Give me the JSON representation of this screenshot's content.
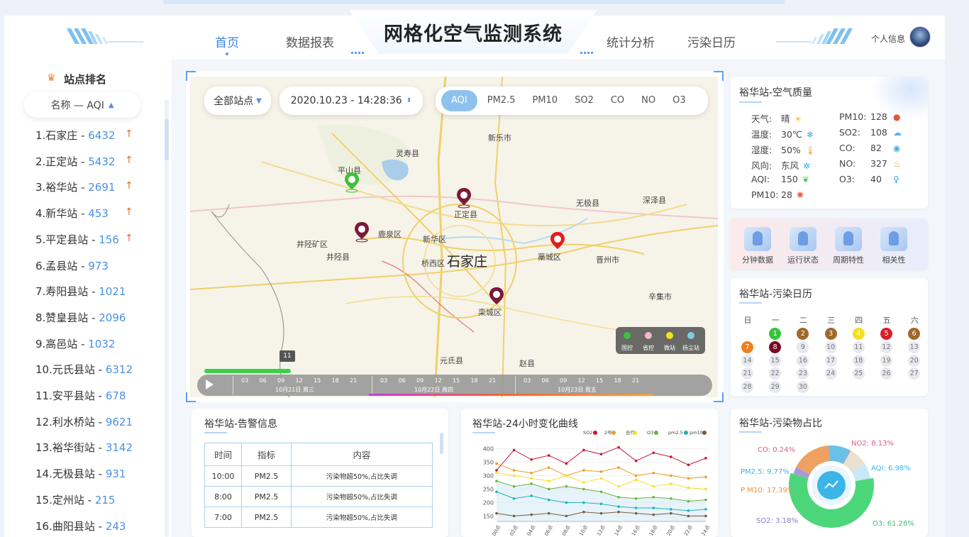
{
  "app": {
    "title": "网格化空气监测系统",
    "user_label": "个人信息"
  },
  "nav": [
    {
      "label": "首页",
      "active": true
    },
    {
      "label": "数据报表",
      "active": false
    },
    {
      "label": "统计分析",
      "active": false
    },
    {
      "label": "污染日历",
      "active": false
    }
  ],
  "ranking": {
    "title": "站点排名",
    "sort_label": "名称 — AQI",
    "items": [
      {
        "name": "1.石家庄",
        "value": "6432",
        "up": true
      },
      {
        "name": "2.正定站",
        "value": "5432",
        "up": true
      },
      {
        "name": "3.裕华站",
        "value": "2691",
        "up": true
      },
      {
        "name": "4.新华站",
        "value": "453",
        "up": true
      },
      {
        "name": "5.平定县站",
        "value": "156",
        "up": true
      },
      {
        "name": "6.孟县站",
        "value": "973",
        "up": false
      },
      {
        "name": "7.寿阳县站",
        "value": "1021",
        "up": false
      },
      {
        "name": "8.赞皇县站",
        "value": "2096",
        "up": false
      },
      {
        "name": "9.高邑站",
        "value": "1032",
        "up": false
      },
      {
        "name": "10.元氏县站",
        "value": "6312",
        "up": false
      },
      {
        "name": "11.安平县站",
        "value": "678",
        "up": false
      },
      {
        "name": "12.利水桥站",
        "value": "9621",
        "up": false
      },
      {
        "name": "13.裕华街站",
        "value": "3142",
        "up": false
      },
      {
        "name": "14.无极县站",
        "value": "931",
        "up": false
      },
      {
        "name": "15.定州站",
        "value": "215",
        "up": false
      },
      {
        "name": "16.曲阳县站",
        "value": "243",
        "up": false
      }
    ]
  },
  "map": {
    "station_select": "全部站点",
    "datetime": "2020.10.23 - 14:28:36",
    "tabs": [
      "AQI",
      "PM2.5",
      "PM10",
      "SO2",
      "CO",
      "NO",
      "O3"
    ],
    "active_tab": "AQI",
    "places": {
      "xinle": "新乐市",
      "lingshou": "灵寿县",
      "pingshan": "平山县",
      "zhengding": "正定县",
      "wuji": "无极县",
      "shenze": "深泽县",
      "jingxing_kq": "井陉矿区",
      "luquan": "鹿泉区",
      "xinhua": "新华区",
      "jingxing": "井陉县",
      "qiaoxi": "桥西区",
      "city": "石家庄",
      "gaocheng": "藁城区",
      "jinzhou": "晋州市",
      "xinji": "辛集市",
      "luancheng": "栾城区",
      "yuanshi": "元氏县",
      "zhao": "赵县"
    },
    "legend": [
      "国控",
      "省控",
      "微站",
      "扬尘站"
    ],
    "badge": "11",
    "timeline": {
      "hours": [
        "03",
        "06",
        "09",
        "12",
        "15",
        "18",
        "21"
      ],
      "days": [
        "10月21日 周三",
        "10月22日 周四",
        "10月23日 周五"
      ]
    }
  },
  "air_quality": {
    "title": "裕华站-空气质量",
    "left": [
      {
        "label": "天气:",
        "value": "晴",
        "icon": "☀",
        "color": "#f2c12e"
      },
      {
        "label": "温度:",
        "value": "30℃",
        "icon": "❄",
        "color": "#3aa6e0"
      },
      {
        "label": "湿度:",
        "value": "50%",
        "icon": "🌡",
        "color": "#f0a040"
      },
      {
        "label": "风向:",
        "value": "东风",
        "icon": "✲",
        "color": "#3aa6e0"
      },
      {
        "label": "AQI:",
        "value": "150",
        "icon": "❦",
        "color": "#5ac85a"
      },
      {
        "label": "PM10:",
        "value": "28",
        "icon": "✺",
        "color": "#e85c3a"
      }
    ],
    "right": [
      {
        "label": "PM10:",
        "value": "128",
        "icon": "●",
        "color": "#e0573a"
      },
      {
        "label": "SO2:",
        "value": "108",
        "icon": "☁",
        "color": "#5ab0e6"
      },
      {
        "label": "CO:",
        "value": "82",
        "icon": "◉",
        "color": "#4ab0d8"
      },
      {
        "label": "NO:",
        "value": "327",
        "icon": "♨",
        "color": "#f0a030"
      },
      {
        "label": "O3:",
        "value": "40",
        "icon": "♀",
        "color": "#3aa6e0"
      }
    ]
  },
  "quick_links": [
    "分钟数据",
    "运行状态",
    "周期特性",
    "相关性"
  ],
  "calendar": {
    "title": "裕华站-污染日历",
    "weekdays": [
      "日",
      "一",
      "二",
      "三",
      "四",
      "五",
      "六"
    ],
    "days": [
      {
        "d": "1",
        "color": "#3cc23c"
      },
      {
        "d": "2",
        "color": "#a0682a"
      },
      {
        "d": "3",
        "color": "#a0682a"
      },
      {
        "d": "4",
        "color": "#f5e020"
      },
      {
        "d": "5",
        "color": "#d8202a"
      },
      {
        "d": "6",
        "color": "#a0682a"
      },
      {
        "d": "7",
        "color": "#f08020"
      },
      {
        "d": "8",
        "color": "#7a0a24"
      },
      {
        "d": "9"
      },
      {
        "d": "10"
      },
      {
        "d": "11"
      },
      {
        "d": "12"
      },
      {
        "d": "13"
      },
      {
        "d": "14"
      },
      {
        "d": "15"
      },
      {
        "d": "16"
      },
      {
        "d": "17"
      },
      {
        "d": "18"
      },
      {
        "d": "19"
      },
      {
        "d": "20"
      },
      {
        "d": "21"
      },
      {
        "d": "22"
      },
      {
        "d": "23"
      },
      {
        "d": "24"
      },
      {
        "d": "25"
      },
      {
        "d": "26"
      },
      {
        "d": "27"
      },
      {
        "d": "28"
      },
      {
        "d": "29"
      },
      {
        "d": "30"
      }
    ]
  },
  "alarm": {
    "title": "裕华站-告警信息",
    "headers": [
      "时间",
      "指标",
      "内容"
    ],
    "rows": [
      [
        "10:00",
        "PM2.5",
        "污染物超50%,占比失调"
      ],
      [
        "8:00",
        "PM2.5",
        "污染物超50%,占比失调"
      ],
      [
        "7:00",
        "PM2.5",
        "污染物超50%,占比失调"
      ]
    ]
  },
  "curve": {
    "title": "裕华站-24小时变化曲线",
    "legend": [
      {
        "name": "SO2",
        "color": "#c8163a"
      },
      {
        "name": "2号",
        "color": "#f09a2a"
      },
      {
        "name": "合作",
        "color": "#f5e02a"
      },
      {
        "name": "O3",
        "color": "#6cb33e"
      },
      {
        "name": "pm2.5",
        "color": "#1fb3b8"
      },
      {
        "name": "pm10",
        "color": "#7a5a3a"
      }
    ]
  },
  "chart_data": {
    "type": "line",
    "title": "裕华站-24小时变化曲线",
    "x": [
      "00点",
      "02点",
      "04点",
      "06点",
      "08点",
      "10点",
      "12点",
      "14点",
      "16点",
      "18点",
      "20点",
      "22点",
      "24点"
    ],
    "yticks": [
      150,
      200,
      250,
      300,
      350,
      400
    ],
    "ylim": [
      130,
      420
    ],
    "series": [
      {
        "name": "SO2",
        "values": [
          320,
          395,
          360,
          375,
          345,
          395,
          380,
          405,
          355,
          385,
          370,
          340,
          365
        ]
      },
      {
        "name": "2号",
        "values": [
          345,
          320,
          310,
          330,
          300,
          320,
          315,
          330,
          300,
          310,
          300,
          290,
          295
        ]
      },
      {
        "name": "合作",
        "values": [
          310,
          300,
          290,
          280,
          300,
          275,
          290,
          260,
          285,
          260,
          270,
          255,
          250
        ]
      },
      {
        "name": "O3",
        "values": [
          280,
          260,
          270,
          250,
          260,
          250,
          240,
          220,
          215,
          220,
          215,
          205,
          210
        ]
      },
      {
        "name": "pm2.5",
        "values": [
          240,
          215,
          225,
          210,
          200,
          200,
          195,
          185,
          180,
          180,
          175,
          170,
          175
        ]
      },
      {
        "name": "pm10",
        "values": [
          160,
          150,
          155,
          160,
          150,
          165,
          160,
          165,
          160,
          155,
          160,
          150,
          150
        ]
      }
    ]
  },
  "pie": {
    "title": "裕华站-污染物占比",
    "slices": [
      {
        "label": "CO: 0.24%",
        "value": 0.24,
        "color": "#f06c8c"
      },
      {
        "label": "NO2: 8.13%",
        "value": 8.13,
        "color": "#e9e0d0"
      },
      {
        "label": "AQI: 6.98%",
        "value": 6.98,
        "color": "#c8e8f8"
      },
      {
        "label": "O3: 61.28%",
        "value": 61.28,
        "color": "#4cd67a"
      },
      {
        "label": "SO2: 3.18%",
        "value": 3.18,
        "color": "#a89ad8"
      },
      {
        "label": "P M10: 17.39%",
        "value": 17.39,
        "color": "#f0a060"
      },
      {
        "label": "PM2.5: 9.77%",
        "value": 9.77,
        "color": "#6bc0e8"
      }
    ]
  }
}
